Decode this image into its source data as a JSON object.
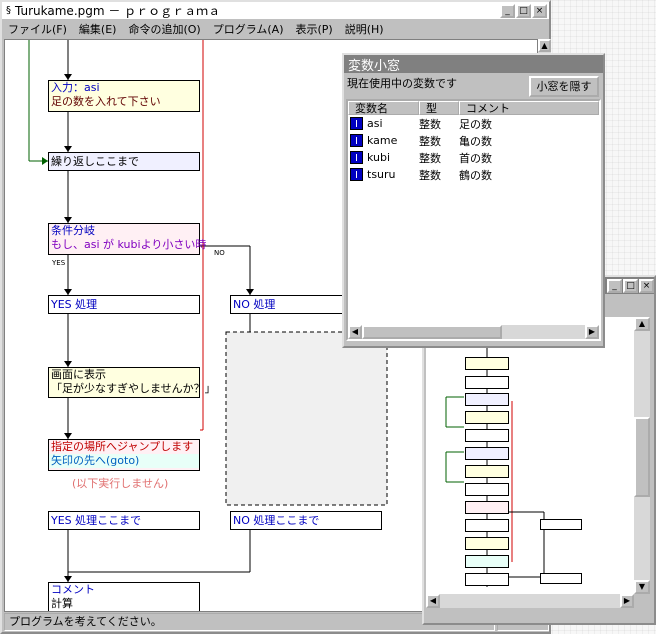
{
  "main": {
    "title": "Turukame.pgm － ｐｒｏｇｒａｍａ",
    "menu": [
      "ファイル(F)",
      "編集(E)",
      "命令の追加(O)",
      "プログラム(A)",
      "表示(P)",
      "説明(H)"
    ],
    "status": "プログラムを考えてください。",
    "blocks": {
      "input_title": "入力：asi",
      "input_desc": "足の数を入れて下さい",
      "loop_end": "繰り返しここまで",
      "cond_title": "条件分岐",
      "cond_desc": "もし、asi が kubiより小さい時",
      "yes_label": "YES",
      "no_label": "NO",
      "yes_proc": "YES 処理",
      "no_proc": "NO 処理",
      "display_title": "画面に表示",
      "display_desc": "「足が少なすぎやしませんか？」",
      "jump_title": "指定の場所へジャンプします",
      "jump_desc": "矢印の先へ(goto)",
      "not_executed": "(以下実行しません)",
      "yes_end": "YES 処理ここまで",
      "no_end": "NO 処理ここまで",
      "comment_title": "コメント",
      "comment_desc": "計算"
    }
  },
  "vars": {
    "title": "変数小窓",
    "subtitle": "現在使用中の変数です",
    "hide_button": "小窓を隠す",
    "columns": [
      "変数名",
      "型",
      "コメント"
    ],
    "icon_letter": "I",
    "rows": [
      {
        "name": "asi",
        "type": "整数",
        "comment": "足の数"
      },
      {
        "name": "kame",
        "type": "整数",
        "comment": "亀の数"
      },
      {
        "name": "kubi",
        "type": "整数",
        "comment": "首の数"
      },
      {
        "name": "tsuru",
        "type": "整数",
        "comment": "鶴の数"
      }
    ]
  },
  "colors": {
    "input_bg": "#ffffe0",
    "loop_bg": "#f0f0ff",
    "cond_bg": "#fff0f4",
    "cond_text": "#0000c0",
    "jump_bg": "#fff0f4",
    "jump_text": "#c00000",
    "yes_text": "#0000c0",
    "red_line": "#d00000",
    "green_line": "#006000"
  }
}
